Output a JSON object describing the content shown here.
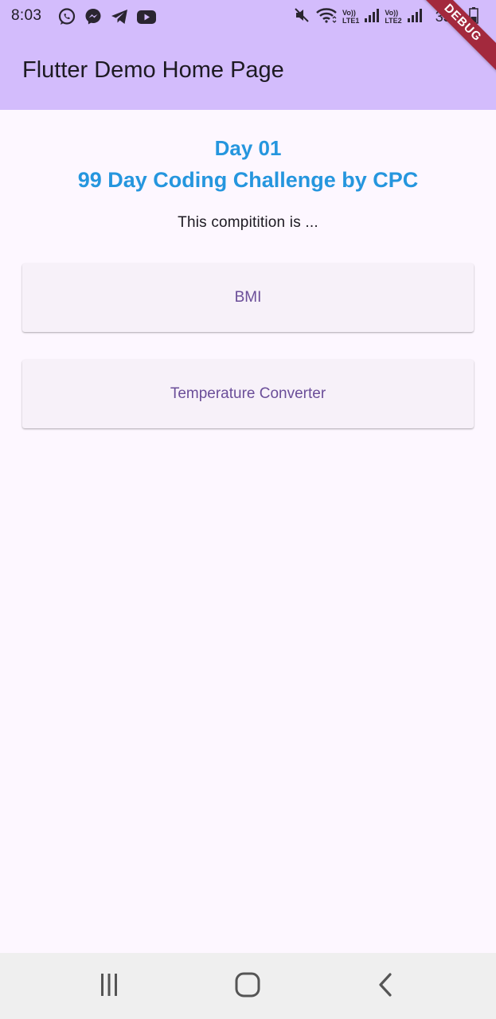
{
  "status_bar": {
    "time": "8:03",
    "lte1_top": "Vo))",
    "lte1_bottom": "LTE1",
    "lte2_top": "Vo))",
    "lte2_bottom": "LTE2",
    "battery": "35%",
    "app_icons": [
      "whatsapp-icon",
      "messenger-icon",
      "telegram-icon",
      "youtube-icon"
    ]
  },
  "debug_banner": "DEBUG",
  "app_bar": {
    "title": "Flutter Demo Home Page"
  },
  "main": {
    "day": "Day 01",
    "challenge": "99 Day Coding Challenge by CPC",
    "description": "This compitition is ...",
    "buttons": [
      {
        "label": "BMI"
      },
      {
        "label": "Temperature Converter"
      }
    ]
  },
  "colors": {
    "app_bar": "#d3bcfc",
    "background": "#fdf7ff",
    "heading": "#2596de",
    "button_text": "#6b4e99",
    "button_bg": "#f7f1f9",
    "debug": "#a3293d"
  },
  "nav_bar": {
    "buttons": [
      "recent-apps-icon",
      "home-icon",
      "back-icon"
    ]
  }
}
